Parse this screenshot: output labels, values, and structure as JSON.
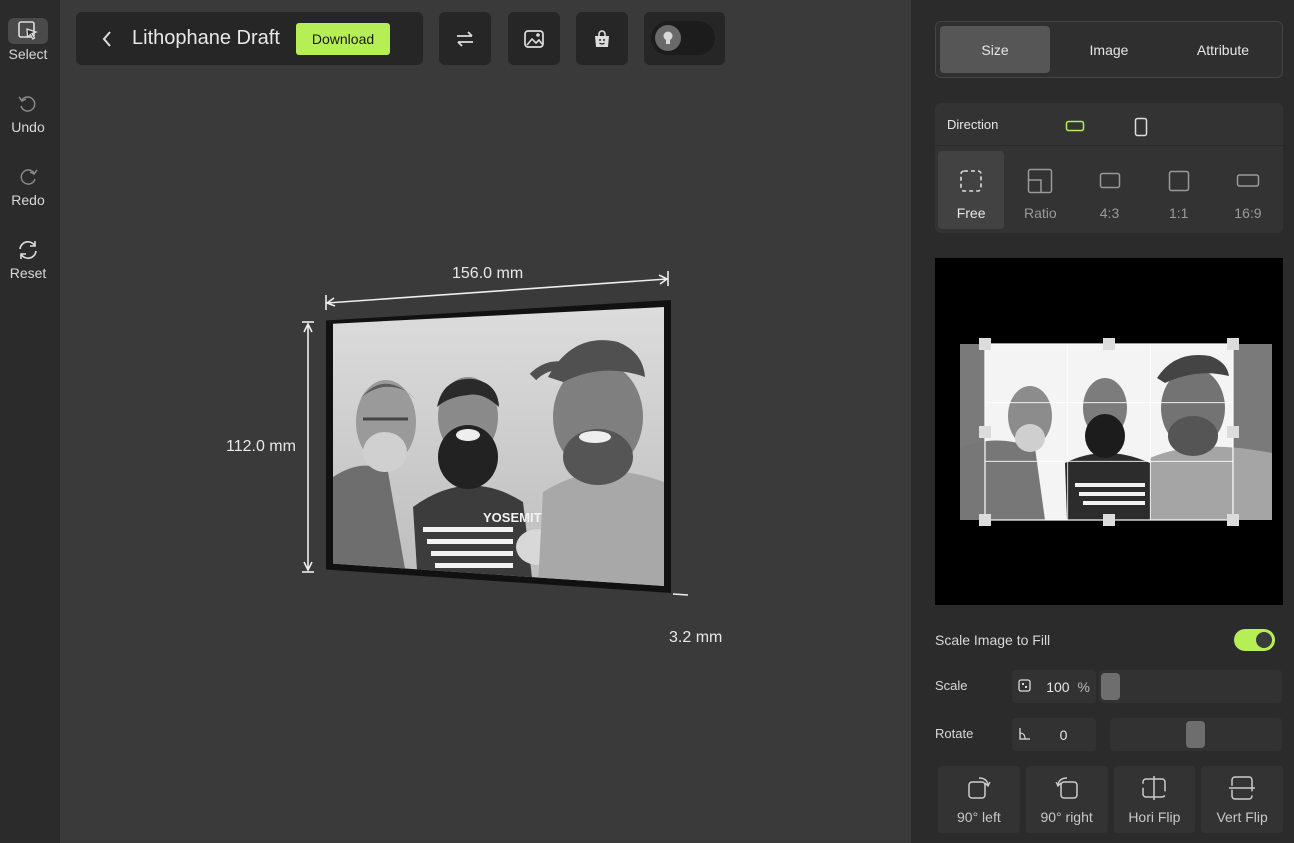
{
  "toolbar": {
    "items": [
      {
        "label": "Select",
        "icon": "cursor-select-icon"
      },
      {
        "label": "Undo",
        "icon": "undo-icon"
      },
      {
        "label": "Redo",
        "icon": "redo-icon"
      },
      {
        "label": "Reset",
        "icon": "reset-icon"
      }
    ]
  },
  "header": {
    "title": "Lithophane Draft",
    "download_label": "Download",
    "icons": [
      "swap-icon",
      "image-edit-icon",
      "shopping-bag-icon",
      "lightbulb-icon"
    ]
  },
  "dimensions": {
    "width": "156.0 mm",
    "height": "112.0 mm",
    "thickness": "3.2 mm"
  },
  "photo": {
    "shirt_text": "YOSEMITE"
  },
  "panel": {
    "tabs": [
      "Size",
      "Image",
      "Attribute"
    ],
    "active_tab": "Size",
    "direction_label": "Direction",
    "ratios": [
      "Free",
      "Ratio",
      "4:3",
      "1:1",
      "16:9"
    ],
    "active_ratio": "Free",
    "fill_label": "Scale Image to Fill",
    "fill_enabled": true,
    "scale_label": "Scale",
    "scale_value": "100",
    "scale_unit": "%",
    "rotate_label": "Rotate",
    "rotate_value": "0",
    "actions": [
      "90° left",
      "90° right",
      "Hori Flip",
      "Vert Flip"
    ]
  },
  "colors": {
    "accent": "#b6ee55",
    "background": "#3a3a3a",
    "panel": "#2b2b2b"
  }
}
